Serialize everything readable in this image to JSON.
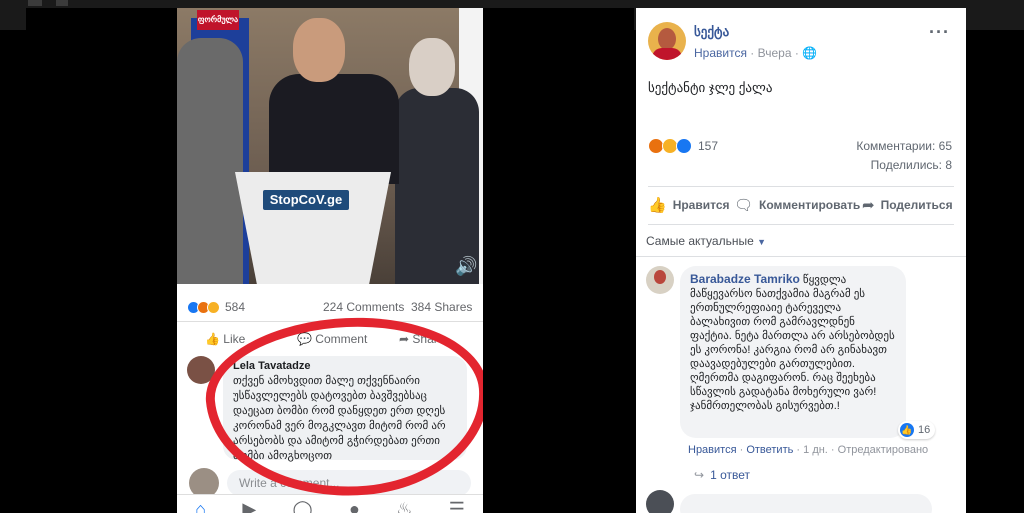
{
  "embedded_screenshot": {
    "video": {
      "channel_logo": "ფორმულა",
      "podium_text": "StopCoV.ge"
    },
    "stats": {
      "reaction_count": "584",
      "comments": "224 Comments",
      "shares": "384 Shares"
    },
    "actions": {
      "like": "Like",
      "comment": "Comment",
      "share": "Share"
    },
    "comment": {
      "author": "Lela Tavatadze",
      "text": "თქვენ ამოხვდით მალე თქვენნაირი უსწავლელებს დატოვებთ ბავშვებსაც დაეცათ ბომბი რომ დანყდეთ ერთ დღეს კორონამ ვერ მოგკლავთ მიტომ რომ არ არსებობს და ამიტომ გჭირდებათ ერთი ბომბი ამოგხოცოთ"
    },
    "write_comment_placeholder": "Write a comment..."
  },
  "post": {
    "author": "სექტა",
    "like_link": "Нравится",
    "time": "Вчера",
    "text": "სექტანტი ჯლე ქალა",
    "reaction_count": "157",
    "comments_count": "Комментарии: 65",
    "shares_count": "Поделились: 8",
    "actions": {
      "like": "Нравится",
      "comment": "Комментировать",
      "share": "Поделиться"
    },
    "sort_label": "Самые актуальные"
  },
  "comment": {
    "author": "Barabadze Tamriko",
    "text": "წყვდლა მაწყევარსო ნათქვამია მაგრამ ეს ერთნულრეფიაიე ტარეველა ბალახივით რომ გამრავლდნენ ფაქტია. ნეტა მართლა არ არსებობდეს ეს კორონა! კარგია რომ არ გინახავთ დაავადებულები გართულებით. ღმერთმა დაგიფარონ. რაც შეეხება სწავლის გადატანა მოხერული ვარ! ჯანმრთელობას გისურვებთ.!",
    "like_count": "16",
    "meta": {
      "like": "Нравится",
      "reply": "Ответить",
      "time": "1 дн.",
      "edited": "Отредактировано"
    },
    "replies": "1 ответ"
  },
  "colors": {
    "facebook_blue": "#385898",
    "highlight_red": "#e3252f"
  }
}
